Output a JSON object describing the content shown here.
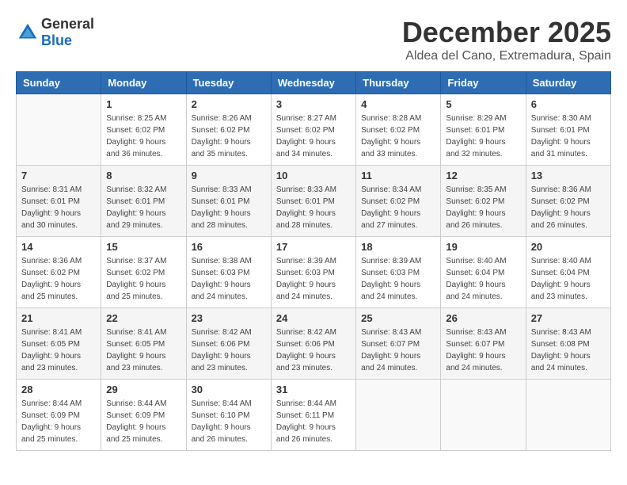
{
  "header": {
    "logo_general": "General",
    "logo_blue": "Blue",
    "month": "December 2025",
    "location": "Aldea del Cano, Extremadura, Spain"
  },
  "weekdays": [
    "Sunday",
    "Monday",
    "Tuesday",
    "Wednesday",
    "Thursday",
    "Friday",
    "Saturday"
  ],
  "weeks": [
    [
      {
        "day": "",
        "sunrise": "",
        "sunset": "",
        "daylight": ""
      },
      {
        "day": "1",
        "sunrise": "Sunrise: 8:25 AM",
        "sunset": "Sunset: 6:02 PM",
        "daylight": "Daylight: 9 hours and 36 minutes."
      },
      {
        "day": "2",
        "sunrise": "Sunrise: 8:26 AM",
        "sunset": "Sunset: 6:02 PM",
        "daylight": "Daylight: 9 hours and 35 minutes."
      },
      {
        "day": "3",
        "sunrise": "Sunrise: 8:27 AM",
        "sunset": "Sunset: 6:02 PM",
        "daylight": "Daylight: 9 hours and 34 minutes."
      },
      {
        "day": "4",
        "sunrise": "Sunrise: 8:28 AM",
        "sunset": "Sunset: 6:02 PM",
        "daylight": "Daylight: 9 hours and 33 minutes."
      },
      {
        "day": "5",
        "sunrise": "Sunrise: 8:29 AM",
        "sunset": "Sunset: 6:01 PM",
        "daylight": "Daylight: 9 hours and 32 minutes."
      },
      {
        "day": "6",
        "sunrise": "Sunrise: 8:30 AM",
        "sunset": "Sunset: 6:01 PM",
        "daylight": "Daylight: 9 hours and 31 minutes."
      }
    ],
    [
      {
        "day": "7",
        "sunrise": "Sunrise: 8:31 AM",
        "sunset": "Sunset: 6:01 PM",
        "daylight": "Daylight: 9 hours and 30 minutes."
      },
      {
        "day": "8",
        "sunrise": "Sunrise: 8:32 AM",
        "sunset": "Sunset: 6:01 PM",
        "daylight": "Daylight: 9 hours and 29 minutes."
      },
      {
        "day": "9",
        "sunrise": "Sunrise: 8:33 AM",
        "sunset": "Sunset: 6:01 PM",
        "daylight": "Daylight: 9 hours and 28 minutes."
      },
      {
        "day": "10",
        "sunrise": "Sunrise: 8:33 AM",
        "sunset": "Sunset: 6:01 PM",
        "daylight": "Daylight: 9 hours and 28 minutes."
      },
      {
        "day": "11",
        "sunrise": "Sunrise: 8:34 AM",
        "sunset": "Sunset: 6:02 PM",
        "daylight": "Daylight: 9 hours and 27 minutes."
      },
      {
        "day": "12",
        "sunrise": "Sunrise: 8:35 AM",
        "sunset": "Sunset: 6:02 PM",
        "daylight": "Daylight: 9 hours and 26 minutes."
      },
      {
        "day": "13",
        "sunrise": "Sunrise: 8:36 AM",
        "sunset": "Sunset: 6:02 PM",
        "daylight": "Daylight: 9 hours and 26 minutes."
      }
    ],
    [
      {
        "day": "14",
        "sunrise": "Sunrise: 8:36 AM",
        "sunset": "Sunset: 6:02 PM",
        "daylight": "Daylight: 9 hours and 25 minutes."
      },
      {
        "day": "15",
        "sunrise": "Sunrise: 8:37 AM",
        "sunset": "Sunset: 6:02 PM",
        "daylight": "Daylight: 9 hours and 25 minutes."
      },
      {
        "day": "16",
        "sunrise": "Sunrise: 8:38 AM",
        "sunset": "Sunset: 6:03 PM",
        "daylight": "Daylight: 9 hours and 24 minutes."
      },
      {
        "day": "17",
        "sunrise": "Sunrise: 8:39 AM",
        "sunset": "Sunset: 6:03 PM",
        "daylight": "Daylight: 9 hours and 24 minutes."
      },
      {
        "day": "18",
        "sunrise": "Sunrise: 8:39 AM",
        "sunset": "Sunset: 6:03 PM",
        "daylight": "Daylight: 9 hours and 24 minutes."
      },
      {
        "day": "19",
        "sunrise": "Sunrise: 8:40 AM",
        "sunset": "Sunset: 6:04 PM",
        "daylight": "Daylight: 9 hours and 24 minutes."
      },
      {
        "day": "20",
        "sunrise": "Sunrise: 8:40 AM",
        "sunset": "Sunset: 6:04 PM",
        "daylight": "Daylight: 9 hours and 23 minutes."
      }
    ],
    [
      {
        "day": "21",
        "sunrise": "Sunrise: 8:41 AM",
        "sunset": "Sunset: 6:05 PM",
        "daylight": "Daylight: 9 hours and 23 minutes."
      },
      {
        "day": "22",
        "sunrise": "Sunrise: 8:41 AM",
        "sunset": "Sunset: 6:05 PM",
        "daylight": "Daylight: 9 hours and 23 minutes."
      },
      {
        "day": "23",
        "sunrise": "Sunrise: 8:42 AM",
        "sunset": "Sunset: 6:06 PM",
        "daylight": "Daylight: 9 hours and 23 minutes."
      },
      {
        "day": "24",
        "sunrise": "Sunrise: 8:42 AM",
        "sunset": "Sunset: 6:06 PM",
        "daylight": "Daylight: 9 hours and 23 minutes."
      },
      {
        "day": "25",
        "sunrise": "Sunrise: 8:43 AM",
        "sunset": "Sunset: 6:07 PM",
        "daylight": "Daylight: 9 hours and 24 minutes."
      },
      {
        "day": "26",
        "sunrise": "Sunrise: 8:43 AM",
        "sunset": "Sunset: 6:07 PM",
        "daylight": "Daylight: 9 hours and 24 minutes."
      },
      {
        "day": "27",
        "sunrise": "Sunrise: 8:43 AM",
        "sunset": "Sunset: 6:08 PM",
        "daylight": "Daylight: 9 hours and 24 minutes."
      }
    ],
    [
      {
        "day": "28",
        "sunrise": "Sunrise: 8:44 AM",
        "sunset": "Sunset: 6:09 PM",
        "daylight": "Daylight: 9 hours and 25 minutes."
      },
      {
        "day": "29",
        "sunrise": "Sunrise: 8:44 AM",
        "sunset": "Sunset: 6:09 PM",
        "daylight": "Daylight: 9 hours and 25 minutes."
      },
      {
        "day": "30",
        "sunrise": "Sunrise: 8:44 AM",
        "sunset": "Sunset: 6:10 PM",
        "daylight": "Daylight: 9 hours and 26 minutes."
      },
      {
        "day": "31",
        "sunrise": "Sunrise: 8:44 AM",
        "sunset": "Sunset: 6:11 PM",
        "daylight": "Daylight: 9 hours and 26 minutes."
      },
      {
        "day": "",
        "sunrise": "",
        "sunset": "",
        "daylight": ""
      },
      {
        "day": "",
        "sunrise": "",
        "sunset": "",
        "daylight": ""
      },
      {
        "day": "",
        "sunrise": "",
        "sunset": "",
        "daylight": ""
      }
    ]
  ]
}
